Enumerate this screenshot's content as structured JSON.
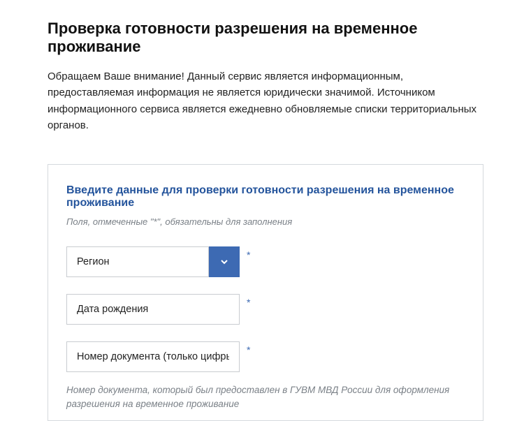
{
  "header": {
    "title": "Проверка готовности разрешения на временное проживание",
    "intro": "Обращаем Ваше внимание! Данный сервис является информационным, предоставляемая информация не является юридически значимой. Источником информационного сервиса является ежедневно обновляемые списки территориальных органов."
  },
  "form": {
    "title": "Введите данные для проверки готовности разрешения на временное проживание",
    "required_note": "Поля, отмеченные \"*\", обязательны для заполнения",
    "asterisk": "*",
    "region": {
      "label": "Регион"
    },
    "birth": {
      "placeholder": "Дата рождения"
    },
    "doc": {
      "placeholder": "Номер документа (только цифры)",
      "hint": "Номер документа, который был предоставлен в ГУВМ МВД России для оформления разрешения на временное проживание"
    }
  }
}
